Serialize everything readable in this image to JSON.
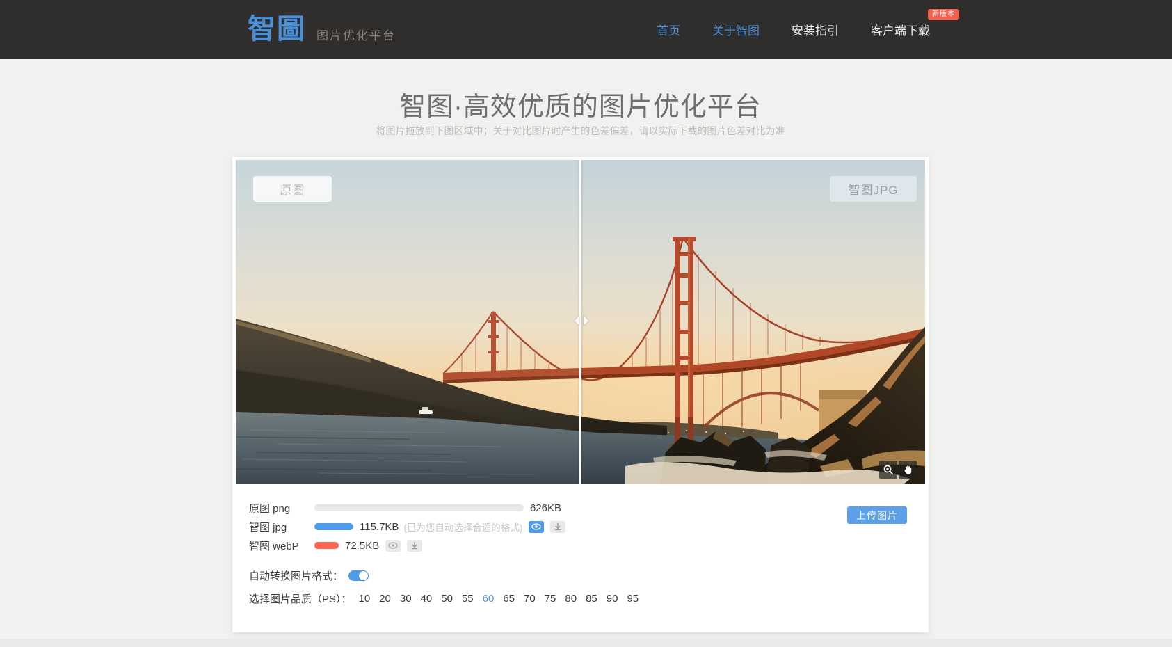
{
  "header": {
    "logo": "智圖",
    "tagline": "图片优化平台",
    "nav": [
      {
        "label": "首页"
      },
      {
        "label": "关于智图"
      },
      {
        "label": "安装指引"
      },
      {
        "label": "客户端下载"
      }
    ],
    "badge": "新版本"
  },
  "hero": {
    "title": "智图·高效优质的图片优化平台",
    "subtitle": "将图片拖放到下图区域中；关于对比图片时产生的色差偏差，请以实际下载的图片色差对比为准"
  },
  "compare": {
    "left_label": "原图",
    "right_label": "智图JPG"
  },
  "results": {
    "rows": [
      {
        "label": "原图 png",
        "size": "626KB",
        "note": ""
      },
      {
        "label": "智图 jpg",
        "size": "115.7KB",
        "note": "(已为您自动选择合适的格式)"
      },
      {
        "label": "智图 webP",
        "size": "72.5KB",
        "note": ""
      }
    ],
    "upload_button": "上传图片"
  },
  "options": {
    "auto_convert_label": "自动转换图片格式：",
    "toggle_state": "on",
    "quality_label": "选择图片品质（PS）：",
    "qualities": [
      "10",
      "20",
      "30",
      "40",
      "50",
      "55",
      "60",
      "65",
      "70",
      "75",
      "80",
      "85",
      "90",
      "95"
    ],
    "selected_quality": "60"
  },
  "colors": {
    "accent_blue": "#4f9bea",
    "bar_gray": "#e9e9e9",
    "bar_red": "#fa6450",
    "badge_red": "#f4604d",
    "header_bg": "#302e2d",
    "page_bg": "#f1f1ef"
  }
}
